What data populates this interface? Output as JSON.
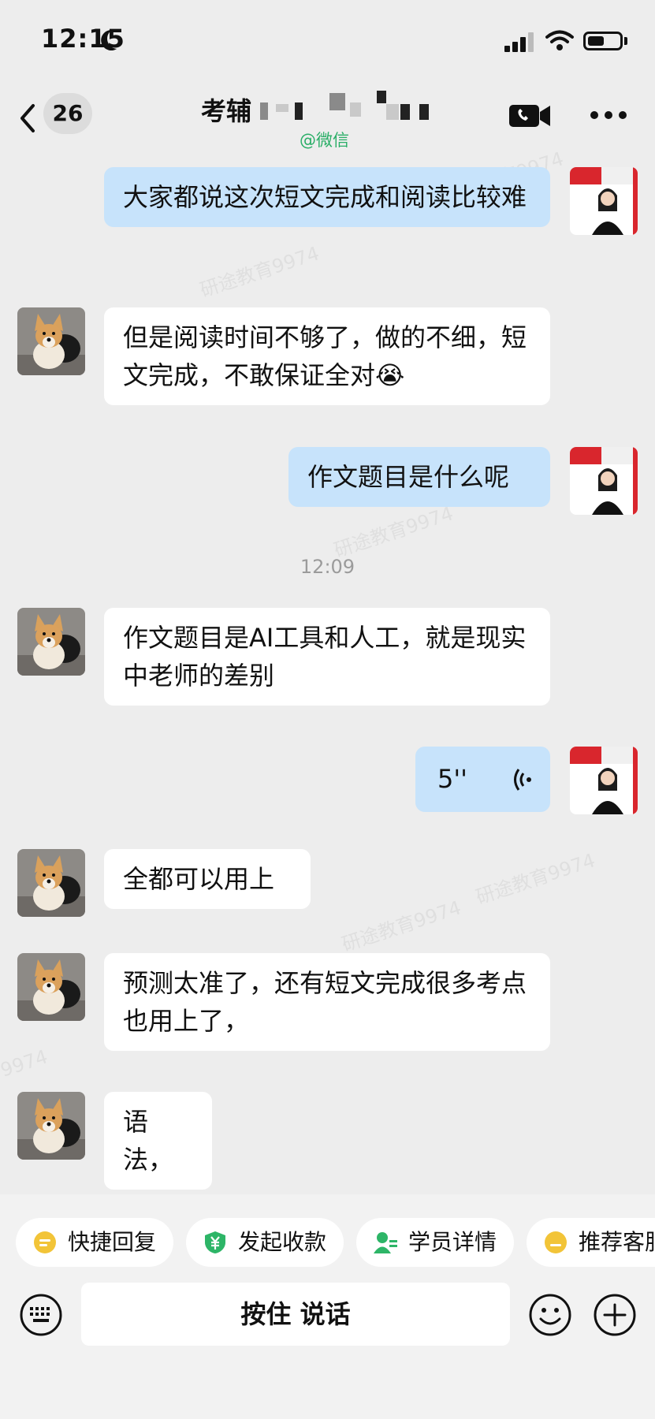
{
  "status_bar": {
    "time": "12:15"
  },
  "nav": {
    "back_count": "26",
    "title": "考辅",
    "subtitle": "@微信"
  },
  "messages": [
    {
      "side": "out",
      "text": "大家都说这次短文完成和阅读比较难"
    },
    {
      "side": "in",
      "text": "但是阅读时间不够了，做的不细，短文完成，不敢保证全对😭"
    },
    {
      "side": "out",
      "text": "作文题目是什么呢"
    },
    {
      "side": "in",
      "text": "作文题目是AI工具和人工，就是现实中老师的差别"
    },
    {
      "side": "out",
      "voice": "5''"
    },
    {
      "side": "in",
      "text": "全都可以用上"
    },
    {
      "side": "in",
      "text": "预测太准了，还有短文完成很多考点也用上了，"
    },
    {
      "side": "in",
      "text": "语法，"
    }
  ],
  "timestamp": "12:09",
  "quick_bar": {
    "chips": [
      "快捷回复",
      "发起收款",
      "学员详情",
      "推荐客服"
    ]
  },
  "input_bar": {
    "hold_to_talk": "按住 说话"
  },
  "colors": {
    "background": "#ededed",
    "out_bubble": "#c7e3fb",
    "in_bubble": "#ffffff",
    "wechat_green": "#2aae67",
    "chip_yellow": "#f2c438",
    "chip_green": "#2db567"
  }
}
